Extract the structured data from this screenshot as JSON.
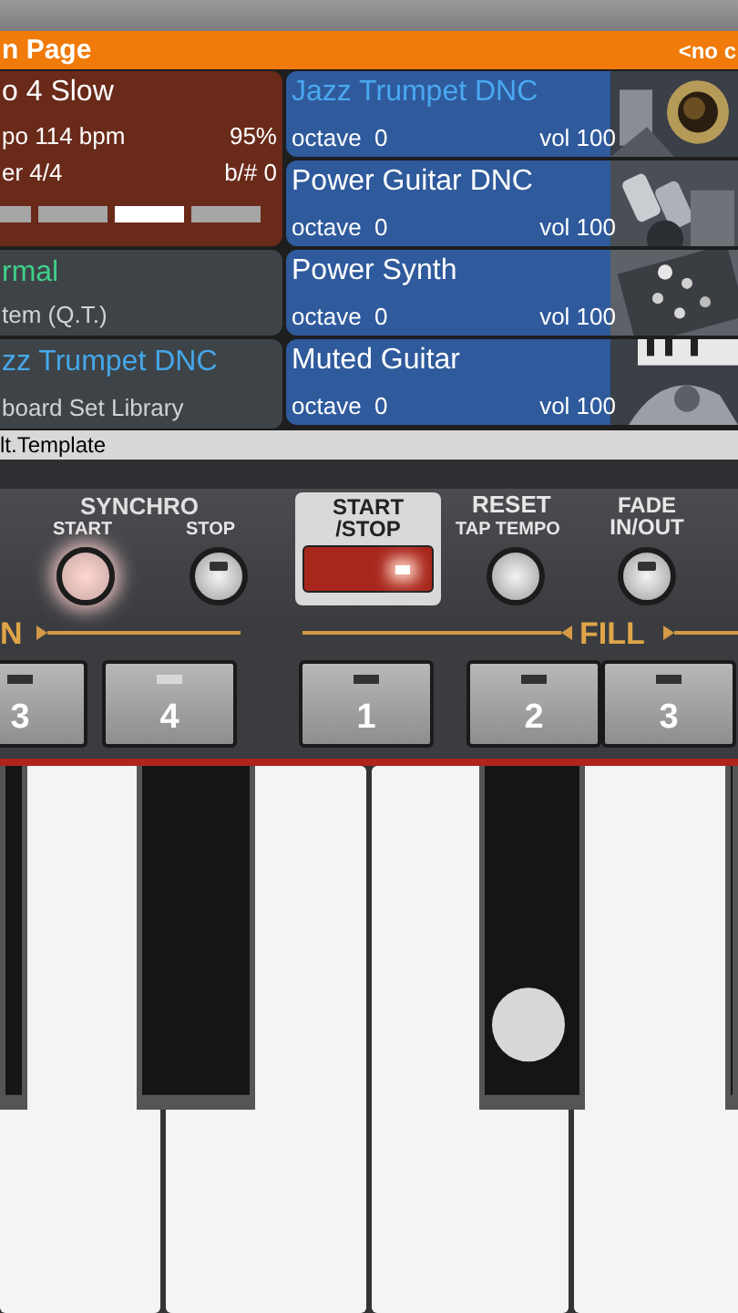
{
  "header": {
    "title": "n Page",
    "right_text": "<no c"
  },
  "style_panel": {
    "name": "o 4 Slow",
    "tempo": "po 114 bpm",
    "percent": "95%",
    "meter": "er 4/4",
    "key": "b/# 0",
    "variations": [
      {
        "selected": false
      },
      {
        "selected": false
      },
      {
        "selected": true
      },
      {
        "selected": false
      }
    ]
  },
  "mode_panel": {
    "title": "rmal",
    "subtitle": "tem (Q.T.)"
  },
  "keyboard_set_panel": {
    "title": "zz Trumpet DNC",
    "subtitle": "board Set Library"
  },
  "tracks": [
    {
      "name": "Jazz Trumpet DNC",
      "octave": "octave  0",
      "volume": "vol 100",
      "selected": true
    },
    {
      "name": "Power Guitar DNC",
      "octave": "octave  0",
      "volume": "vol 100",
      "selected": false
    },
    {
      "name": "Power Synth",
      "octave": "octave  0",
      "volume": "vol 100",
      "selected": false
    },
    {
      "name": "Muted Guitar",
      "octave": "octave  0",
      "volume": "vol 100",
      "selected": false
    }
  ],
  "template_bar": "lt.Template",
  "controls": {
    "group_label": "SYNCHRO",
    "buttons": [
      {
        "label": "START",
        "kind": "round",
        "lit": true
      },
      {
        "label": "STOP",
        "kind": "led",
        "lit": false
      },
      {
        "label": "START /STOP",
        "kind": "main",
        "lit": true
      },
      {
        "label": "RESET",
        "sublabel": "TAP TEMPO",
        "kind": "round",
        "lit": false
      },
      {
        "label": "FADE IN/OUT",
        "kind": "led",
        "lit": false
      }
    ],
    "section_left": "N",
    "section_right": "FILL",
    "pads": [
      {
        "label": "3",
        "lit": false
      },
      {
        "label": "4",
        "lit": true
      },
      {
        "label": "1",
        "lit": false
      },
      {
        "label": "2",
        "lit": false
      },
      {
        "label": "3",
        "lit": false
      }
    ]
  },
  "keyboard": {
    "touch_active": true
  }
}
